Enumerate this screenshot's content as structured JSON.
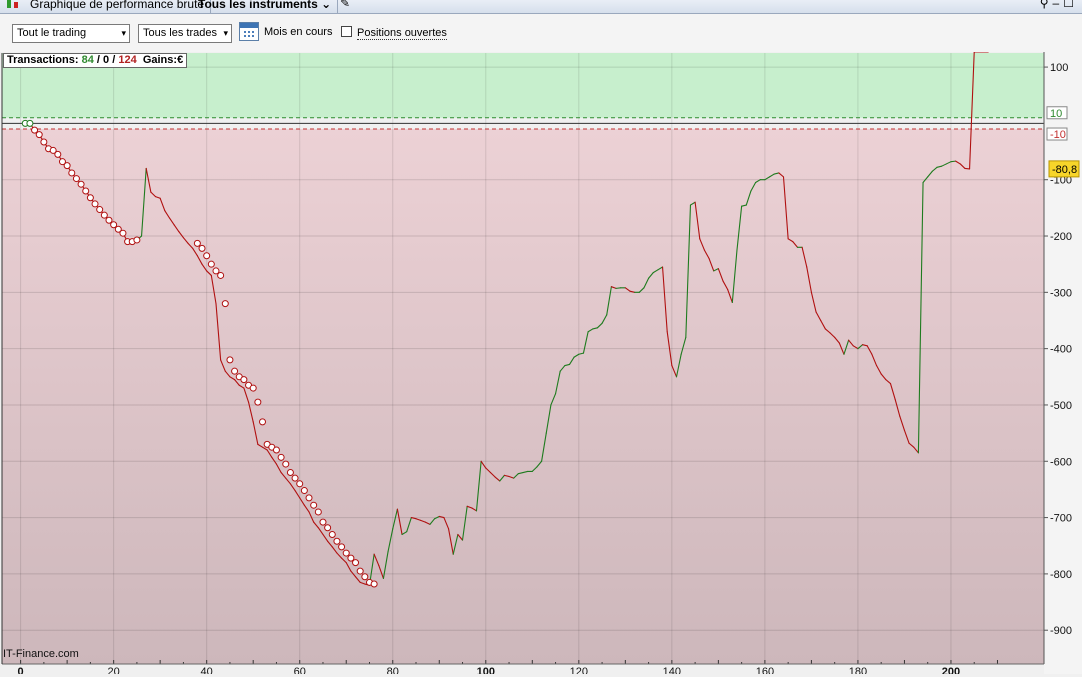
{
  "window": {
    "tab_chart": "Graphique de performance brute",
    "tab_instruments": "Tous les instruments"
  },
  "toolbar": {
    "scope_select": "Tout le trading",
    "trades_select": "Tous les trades",
    "period_label": "Mois en cours",
    "open_positions_label": "Positions ouvertes",
    "open_positions_checked": false
  },
  "info": {
    "transactions_label": "Transactions:",
    "wins": "84",
    "sep1": "/",
    "neutral": "0",
    "sep2": "/",
    "losses": "124",
    "gains_label": "Gains:",
    "currency": "€"
  },
  "watermark": "IT-Finance.com",
  "colors": {
    "profit_zone": "#c7efcd",
    "loss_zone_top": "#ecd1d5",
    "loss_zone_bottom": "#cdb7bb",
    "up_line": "#1e7b1e",
    "down_line": "#b01010",
    "last_value_bg": "#f7d52a"
  },
  "chart_data": {
    "type": "line",
    "xlim": [
      -4,
      220
    ],
    "ylim": [
      -960,
      125
    ],
    "x_ticks": [
      "0",
      "20",
      "40",
      "60",
      "80",
      "100",
      "120",
      "140",
      "160",
      "180",
      "200"
    ],
    "y_ticks": [
      "100",
      "-100",
      "-200",
      "-300",
      "-400",
      "-500",
      "-600",
      "-700",
      "-800",
      "-900"
    ],
    "threshold_labels": [
      "10",
      "-10"
    ],
    "thresholds": [
      10,
      -10
    ],
    "last_value_label": "-80,8",
    "last_value": -80.8,
    "x": [
      1,
      2,
      3,
      4,
      5,
      6,
      7,
      8,
      9,
      10,
      11,
      12,
      13,
      14,
      15,
      16,
      17,
      18,
      19,
      20,
      21,
      22,
      23,
      24,
      25,
      26,
      27,
      28,
      29,
      30,
      31,
      32,
      33,
      34,
      35,
      36,
      37,
      38,
      39,
      40,
      41,
      42,
      43,
      44,
      45,
      46,
      47,
      48,
      49,
      50,
      51,
      52,
      53,
      54,
      55,
      56,
      57,
      58,
      59,
      60,
      61,
      62,
      63,
      64,
      65,
      66,
      67,
      68,
      69,
      70,
      71,
      72,
      73,
      74,
      75,
      76,
      77,
      78,
      79,
      80,
      81,
      82,
      83,
      84,
      85,
      86,
      87,
      88,
      89,
      90,
      91,
      92,
      93,
      94,
      95,
      96,
      97,
      98,
      99,
      100,
      101,
      102,
      103,
      104,
      105,
      106,
      107,
      108,
      109,
      110,
      111,
      112,
      113,
      114,
      115,
      116,
      117,
      118,
      119,
      120,
      121,
      122,
      123,
      124,
      125,
      126,
      127,
      128,
      129,
      130,
      131,
      132,
      133,
      134,
      135,
      136,
      137,
      138,
      139,
      140,
      141,
      142,
      143,
      144,
      145,
      146,
      147,
      148,
      149,
      150,
      151,
      152,
      153,
      154,
      155,
      156,
      157,
      158,
      159,
      160,
      161,
      162,
      163,
      164,
      165,
      166,
      167,
      168,
      169,
      170,
      171,
      172,
      173,
      174,
      175,
      176,
      177,
      178,
      179,
      180,
      181,
      182,
      183,
      184,
      185,
      186,
      187,
      188,
      189,
      190,
      191,
      192,
      193,
      194,
      195,
      196,
      197,
      198,
      199,
      200,
      201,
      202,
      203,
      204,
      205,
      206,
      207,
      208
    ],
    "y": [
      0,
      0,
      -12,
      -20,
      -33,
      -45,
      -48,
      -55,
      -68,
      -75,
      -88,
      -98,
      -108,
      -120,
      -132,
      -143,
      -153,
      -163,
      -172,
      -180,
      -188,
      -195,
      -210,
      -210,
      -207,
      -200,
      -80,
      -122,
      -130,
      -133,
      -155,
      -168,
      -180,
      -192,
      -203,
      -213,
      -222,
      -235,
      -250,
      -262,
      -270,
      -320,
      -420,
      -440,
      -450,
      -455,
      -465,
      -470,
      -495,
      -530,
      -570,
      -575,
      -580,
      -593,
      -605,
      -620,
      -630,
      -640,
      -652,
      -665,
      -678,
      -690,
      -708,
      -718,
      -730,
      -742,
      -752,
      -763,
      -772,
      -780,
      -795,
      -805,
      -815,
      -818,
      -820,
      -765,
      -785,
      -808,
      -760,
      -720,
      -685,
      -730,
      -725,
      -700,
      -702,
      -705,
      -708,
      -712,
      -702,
      -698,
      -700,
      -720,
      -765,
      -730,
      -740,
      -680,
      -683,
      -688,
      -600,
      -612,
      -620,
      -628,
      -635,
      -625,
      -627,
      -630,
      -622,
      -620,
      -618,
      -618,
      -610,
      -600,
      -550,
      -500,
      -480,
      -440,
      -430,
      -428,
      -415,
      -410,
      -408,
      -370,
      -365,
      -363,
      -355,
      -340,
      -290,
      -293,
      -292,
      -292,
      -298,
      -300,
      -300,
      -292,
      -275,
      -265,
      -260,
      -255,
      -370,
      -430,
      -450,
      -410,
      -380,
      -145,
      -140,
      -205,
      -225,
      -240,
      -262,
      -258,
      -280,
      -295,
      -318,
      -225,
      -147,
      -145,
      -120,
      -105,
      -100,
      -100,
      -95,
      -90,
      -88,
      -95,
      -205,
      -210,
      -220,
      -220,
      -255,
      -300,
      -335,
      -350,
      -365,
      -372,
      -380,
      -390,
      -410,
      -385,
      -395,
      -400,
      -393,
      -395,
      -410,
      -430,
      -445,
      -455,
      -462,
      -490,
      -520,
      -545,
      -568,
      -575,
      -585,
      -105,
      -95,
      -85,
      -78,
      -76,
      -72,
      -68,
      -67,
      -72,
      -80,
      -80.8
    ],
    "markers_x": [
      1,
      2,
      3,
      4,
      5,
      6,
      7,
      8,
      9,
      10,
      11,
      12,
      13,
      14,
      15,
      16,
      17,
      18,
      19,
      20,
      21,
      22,
      23,
      24,
      25,
      38,
      39,
      40,
      41,
      42,
      43,
      44,
      45,
      46,
      47,
      48,
      49,
      50,
      51,
      52,
      53,
      54,
      55,
      56,
      57,
      58,
      59,
      60,
      61,
      62,
      63,
      64,
      65,
      66,
      67,
      68,
      69,
      70,
      71,
      72,
      73,
      74,
      75,
      76
    ],
    "markers_y": [
      0,
      0,
      -12,
      -20,
      -33,
      -45,
      -48,
      -55,
      -68,
      -75,
      -88,
      -98,
      -108,
      -120,
      -132,
      -143,
      -153,
      -163,
      -172,
      -180,
      -188,
      -195,
      -210,
      -210,
      -207,
      -213,
      -222,
      -235,
      -250,
      -262,
      -270,
      -320,
      -420,
      -440,
      -450,
      -455,
      -465,
      -470,
      -495,
      -530,
      -570,
      -575,
      -580,
      -593,
      -605,
      -620,
      -630,
      -640,
      -652,
      -665,
      -678,
      -690,
      -708,
      -718,
      -730,
      -742,
      -752,
      -763,
      -772,
      -780,
      -795,
      -805,
      -815,
      -818
    ]
  }
}
